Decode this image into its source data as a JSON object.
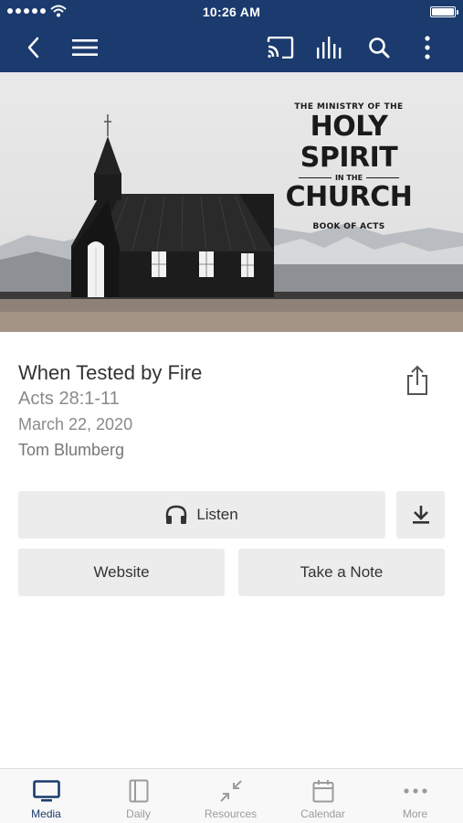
{
  "status_bar": {
    "time": "10:26 AM"
  },
  "nav": {
    "icons": [
      "back-chevron-icon",
      "menu-icon",
      "cast-icon",
      "audio-bars-icon",
      "search-icon",
      "more-vertical-icon"
    ]
  },
  "hero": {
    "line1": "THE MINISTRY OF THE",
    "line2": "HOLY SPIRIT",
    "line3": "IN THE",
    "line4": "CHURCH",
    "line5": "BOOK OF ACTS"
  },
  "sermon": {
    "title": "When Tested by Fire",
    "passage": "Acts 28:1-11",
    "date": "March 22, 2020",
    "speaker": "Tom Blumberg"
  },
  "actions": {
    "listen": "Listen",
    "website": "Website",
    "take_note": "Take a Note"
  },
  "tabs": [
    {
      "label": "Media",
      "icon": "tv-icon",
      "active": true
    },
    {
      "label": "Daily",
      "icon": "book-icon",
      "active": false
    },
    {
      "label": "Resources",
      "icon": "collapse-arrows-icon",
      "active": false
    },
    {
      "label": "Calendar",
      "icon": "calendar-icon",
      "active": false
    },
    {
      "label": "More",
      "icon": "more-horizontal-icon",
      "active": false
    }
  ],
  "colors": {
    "nav_bg": "#1b3a6e",
    "active_tab": "#1b3a6e",
    "inactive_tab": "#9b9b9b",
    "button_bg": "#ececec"
  }
}
